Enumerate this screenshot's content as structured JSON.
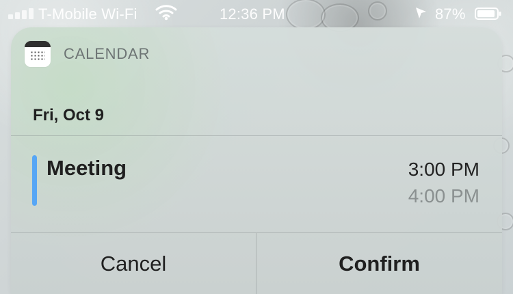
{
  "status_bar": {
    "carrier": "T-Mobile Wi-Fi",
    "time": "12:36 PM",
    "battery_percent": "87%",
    "icons": {
      "signal": "signal-bars-icon",
      "wifi": "wifi-icon",
      "location": "location-arrow-icon",
      "battery": "battery-icon"
    }
  },
  "notification": {
    "app_name": "CALENDAR",
    "date": "Fri, Oct 9",
    "event": {
      "title": "Meeting",
      "start_time": "3:00 PM",
      "end_time": "4:00 PM"
    },
    "actions": {
      "cancel": "Cancel",
      "confirm": "Confirm"
    }
  },
  "colors": {
    "event_accent": "#57a6f5"
  }
}
